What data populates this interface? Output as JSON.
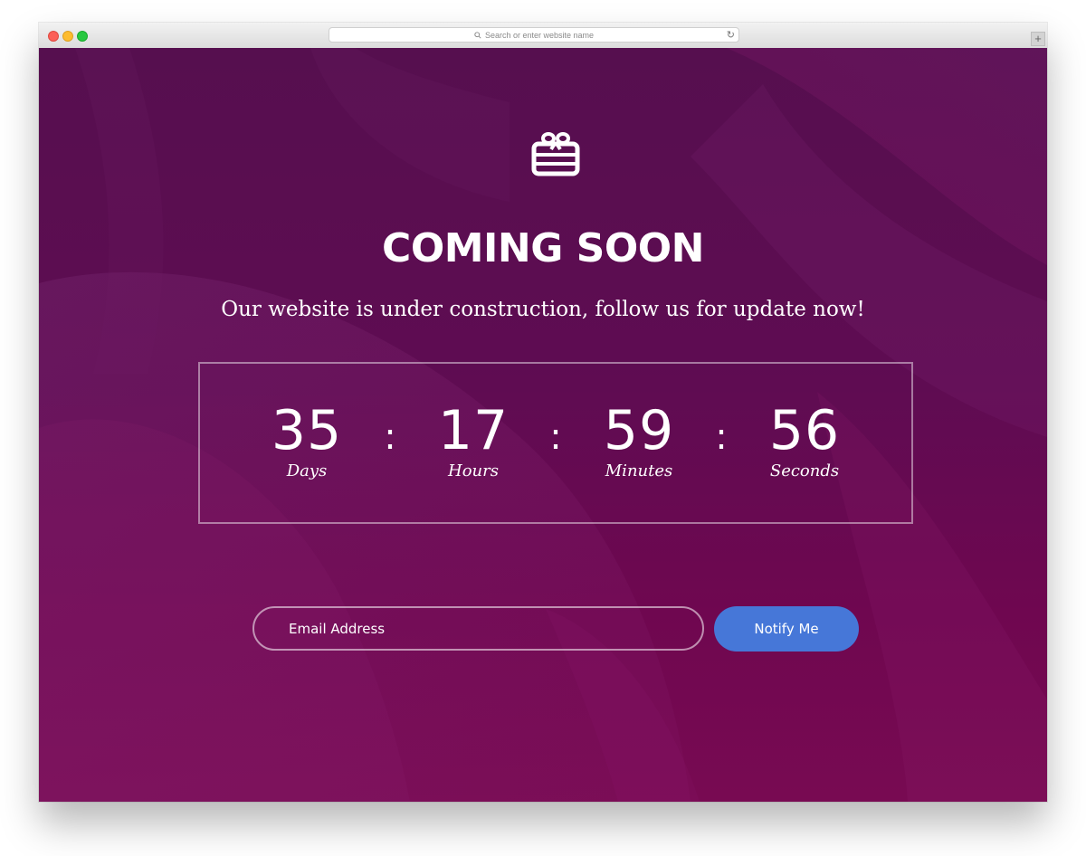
{
  "browser": {
    "address_placeholder": "Search or enter website name",
    "new_tab_label": "+"
  },
  "page": {
    "icon": "gift-box-icon",
    "title": "COMING SOON",
    "subtitle": "Our website is under construction, follow us for update now!",
    "countdown": {
      "days": {
        "value": "35",
        "label": "Days"
      },
      "hours": {
        "value": "17",
        "label": "Hours"
      },
      "minutes": {
        "value": "59",
        "label": "Minutes"
      },
      "seconds": {
        "value": "56",
        "label": "Seconds"
      },
      "separator": ":"
    },
    "subscribe": {
      "email_placeholder": "Email Address",
      "button_label": "Notify Me"
    }
  },
  "colors": {
    "background_top": "#560f4f",
    "background_bottom": "#780a52",
    "button": "#4677d8",
    "text": "#ffffff"
  }
}
